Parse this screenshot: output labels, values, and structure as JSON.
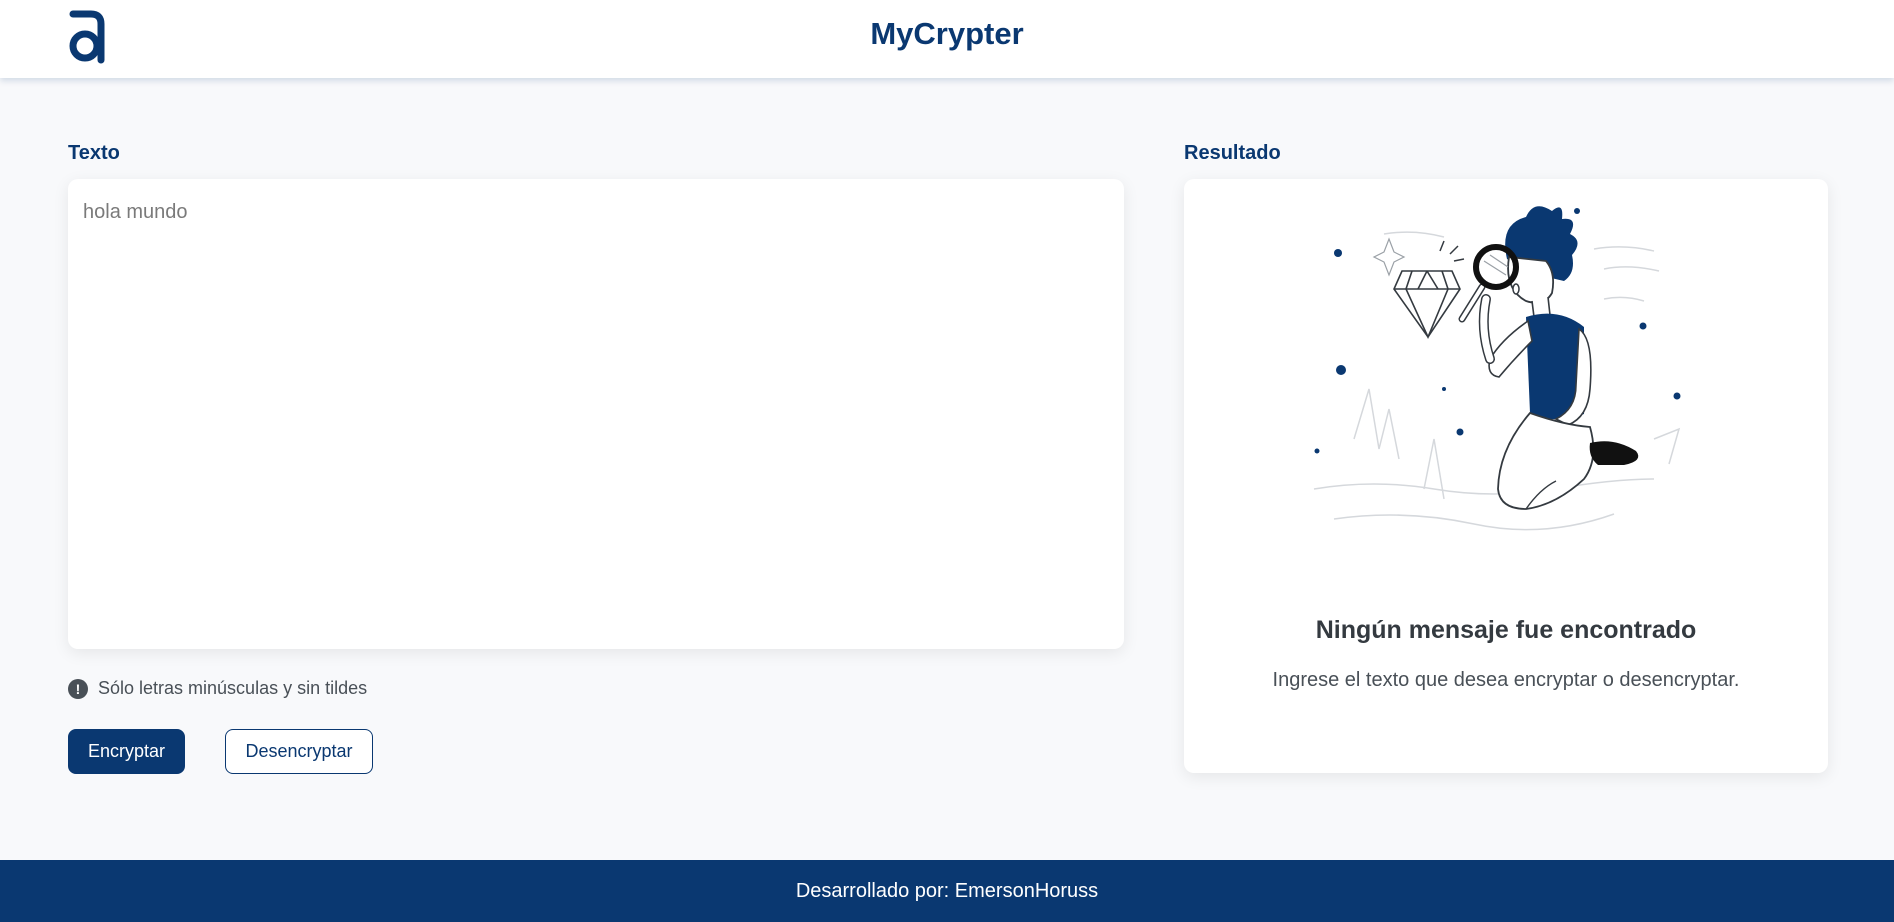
{
  "header": {
    "title": "MyCrypter",
    "logo_icon": "alura-a-logo-icon"
  },
  "input": {
    "label": "Texto",
    "placeholder": "hola mundo",
    "value": ""
  },
  "hint": {
    "icon": "exclamation-circle-icon",
    "icon_glyph": "!",
    "text": "Sólo letras minúsculas y sin tildes"
  },
  "actions": {
    "encrypt_label": "Encryptar",
    "decrypt_label": "Desencryptar"
  },
  "result": {
    "label": "Resultado",
    "illustration": "person-with-magnifying-glass-illustration",
    "empty_title": "Ningún mensaje fue encontrado",
    "empty_description": "Ingrese el texto que desea encryptar o desencryptar."
  },
  "footer": {
    "text": "Desarrollado por: EmersonHoruss"
  },
  "colors": {
    "primary": "#0a3871",
    "background": "#f8f9fb",
    "text_dark": "#343a40",
    "text_muted": "#495057"
  }
}
